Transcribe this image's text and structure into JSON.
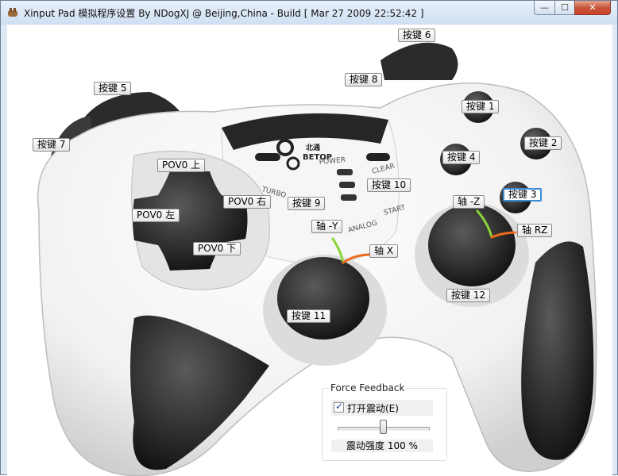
{
  "window": {
    "title": "Xinput Pad 模拟程序设置 By NDogXJ @ Beijing,China - Build [ Mar 27 2009 22:52:42 ]",
    "minimize_glyph": "—",
    "maximize_glyph": "☐",
    "close_glyph": "✕"
  },
  "controller": {
    "brand_logo_text": "BETOP",
    "brand_logo_cn": "北通",
    "printed_labels": [
      "POWER",
      "TURBO",
      "CLEAR",
      "ANALOG",
      "START"
    ]
  },
  "buttons": [
    {
      "id": "button-1",
      "label": "按键 1"
    },
    {
      "id": "button-2",
      "label": "按键 2"
    },
    {
      "id": "button-3",
      "label": "按键 3",
      "focused": true
    },
    {
      "id": "button-4",
      "label": "按键 4"
    },
    {
      "id": "button-5",
      "label": "按键 5"
    },
    {
      "id": "button-6",
      "label": "按键 6"
    },
    {
      "id": "button-7",
      "label": "按键 7"
    },
    {
      "id": "button-8",
      "label": "按键 8"
    },
    {
      "id": "button-9",
      "label": "按键 9"
    },
    {
      "id": "button-10",
      "label": "按键 10"
    },
    {
      "id": "button-11",
      "label": "按键 11"
    },
    {
      "id": "button-12",
      "label": "按键 12"
    }
  ],
  "pov": {
    "up": "POV0 上",
    "down": "POV0 下",
    "left": "POV0 左",
    "right": "POV0 右"
  },
  "axes": {
    "y": "轴 -Y",
    "x": "轴 X",
    "z": "轴 -Z",
    "rz": "轴 RZ"
  },
  "force_feedback": {
    "legend": "Force Feedback",
    "vibration_label": "打开震动(E)",
    "vibration_checked": true,
    "strength_label": "震动强度 100 %",
    "strength_value": 100,
    "slider_position_fraction": 0.5
  },
  "colors": {
    "arrow_green": "#8bd63a",
    "arrow_orange": "#ee6a1c",
    "focus_blue": "#3a8bd6"
  }
}
